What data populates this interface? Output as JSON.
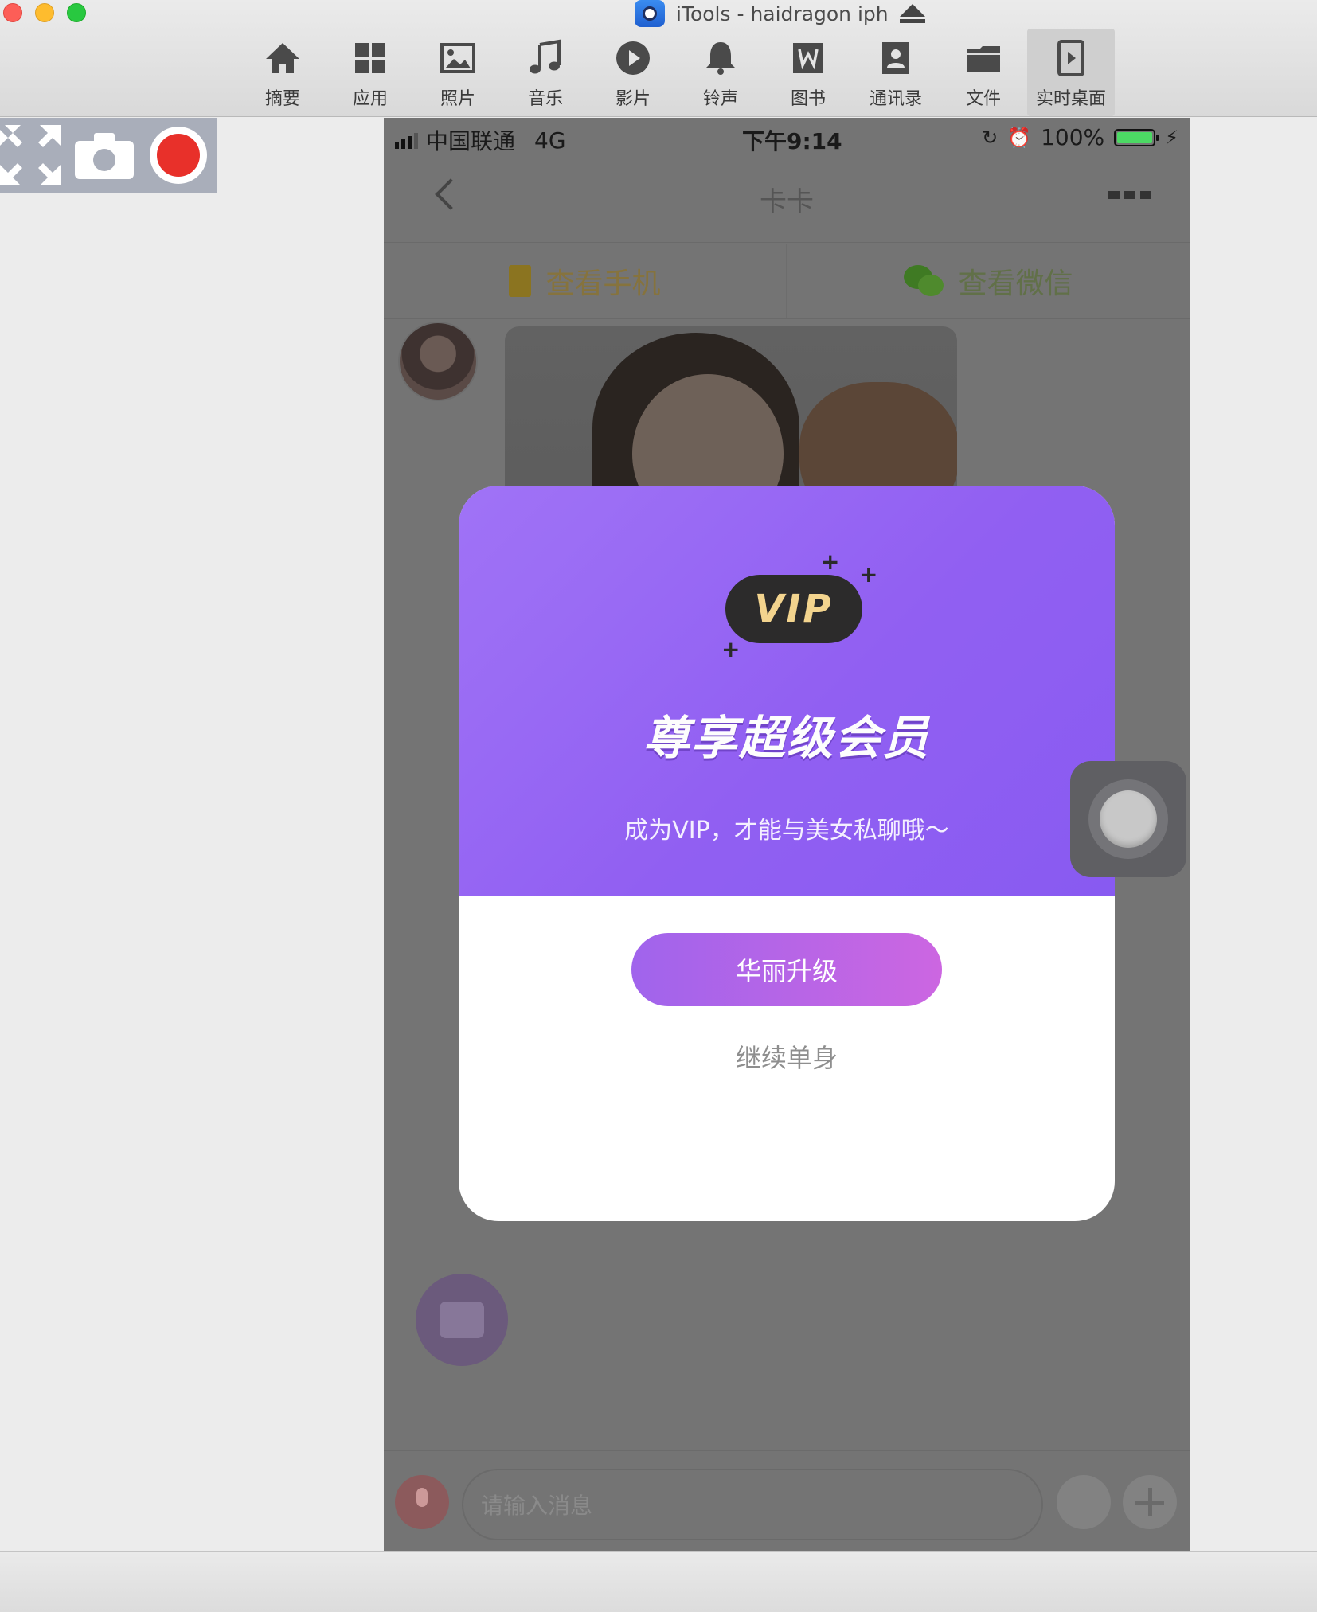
{
  "window": {
    "title": "iTools - haidragon iph"
  },
  "toolbar": {
    "items": [
      {
        "label": "摘要",
        "icon": "home-icon"
      },
      {
        "label": "应用",
        "icon": "apps-icon"
      },
      {
        "label": "照片",
        "icon": "photo-icon"
      },
      {
        "label": "音乐",
        "icon": "music-icon"
      },
      {
        "label": "影片",
        "icon": "play-icon"
      },
      {
        "label": "铃声",
        "icon": "bell-icon"
      },
      {
        "label": "图书",
        "icon": "book-icon"
      },
      {
        "label": "通讯录",
        "icon": "contacts-icon"
      },
      {
        "label": "文件",
        "icon": "folder-icon"
      },
      {
        "label": "实时桌面",
        "icon": "live-desktop-icon",
        "active": true
      }
    ]
  },
  "side_tools": {
    "icons": [
      "fullscreen-icon",
      "camera-icon",
      "record-icon"
    ]
  },
  "status_bar": {
    "carrier": "中国联通",
    "network": "4G",
    "time": "下午9:14",
    "battery": "100%"
  },
  "chat": {
    "title": "卡卡",
    "tabs": {
      "phone": "查看手机",
      "wechat": "查看微信"
    },
    "input_placeholder": "请输入消息"
  },
  "modal": {
    "badge": "VIP",
    "title": "尊享超级会员",
    "subtitle": "成为VIP，才能与美女私聊哦～",
    "upgrade_button": "华丽升级",
    "dismiss_link": "继续单身"
  },
  "colors": {
    "modal_purple": "#8b56f2",
    "button_gradient_start": "#a064ec",
    "button_gradient_end": "#cc66e1",
    "vip_gold": "#f3d48e"
  }
}
